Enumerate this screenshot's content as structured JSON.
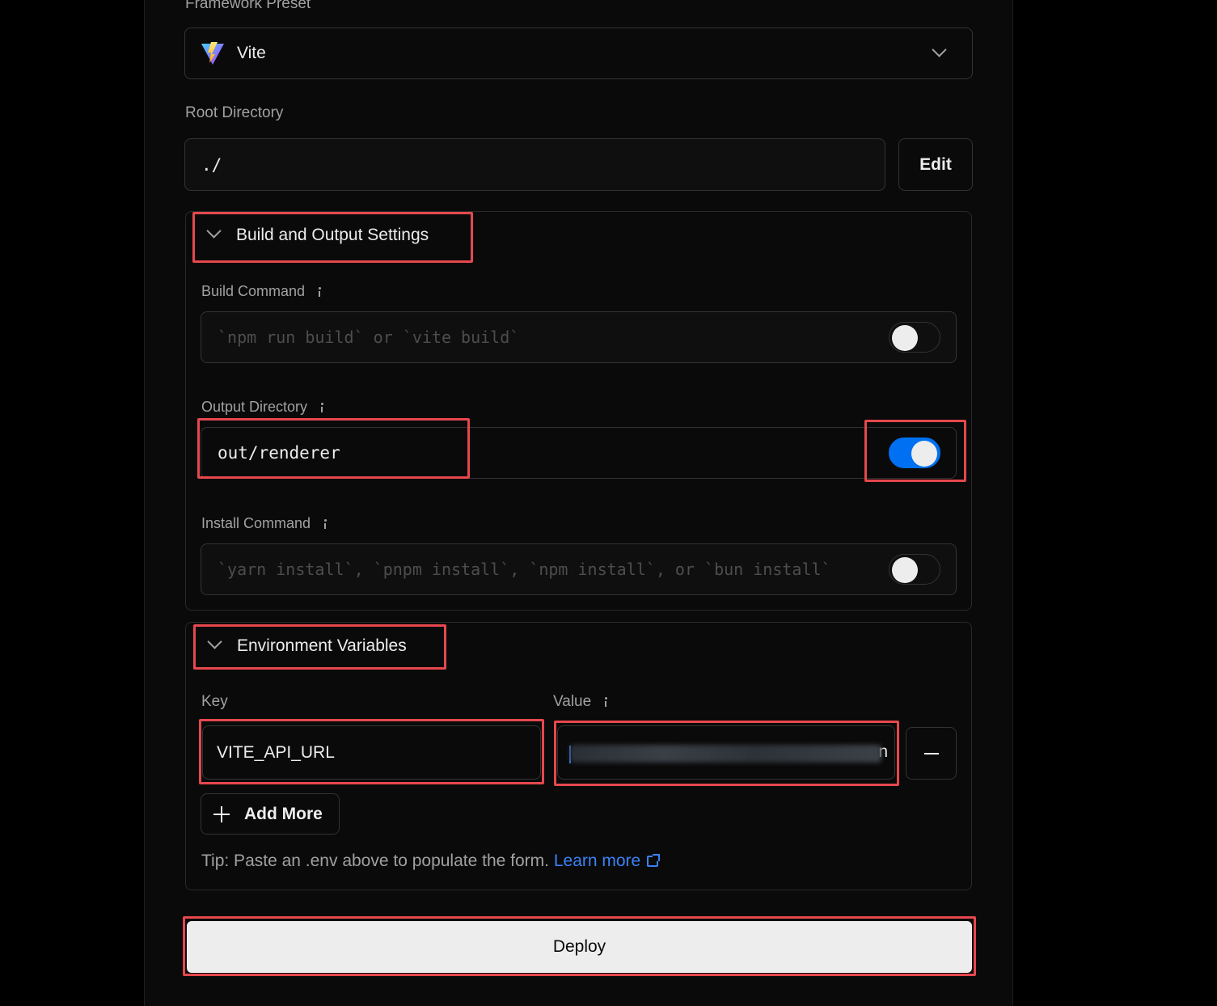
{
  "framework": {
    "label": "Framework Preset",
    "value": "Vite",
    "icon": "vite-logo-icon"
  },
  "root_directory": {
    "label": "Root Directory",
    "value": "./",
    "edit_label": "Edit"
  },
  "build_output": {
    "title": "Build and Output Settings",
    "build_command": {
      "label": "Build Command",
      "placeholder": "`npm run build` or `vite build`",
      "override": false
    },
    "output_directory": {
      "label": "Output Directory",
      "value": "out/renderer",
      "override": true
    },
    "install_command": {
      "label": "Install Command",
      "placeholder": "`yarn install`, `pnpm install`, `npm install`, or `bun install`",
      "override": false
    }
  },
  "env": {
    "title": "Environment Variables",
    "key_label": "Key",
    "value_label": "Value",
    "key_value": "VITE_API_URL",
    "value_suffix": "n",
    "add_more_label": "Add More",
    "tip_text": "Tip: Paste an .env above to populate the form.",
    "learn_more_label": "Learn more"
  },
  "deploy_label": "Deploy",
  "colors": {
    "accent": "#0070f3",
    "highlight": "#e5484d",
    "link": "#3b82f6"
  }
}
